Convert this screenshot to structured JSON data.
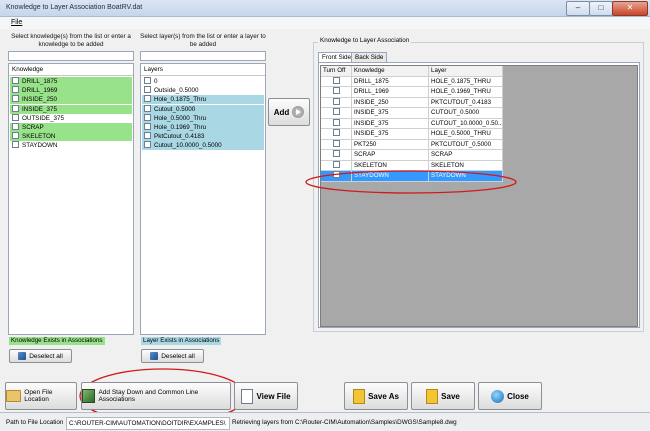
{
  "window": {
    "title": "Knowledge to Layer Association BoatRV.dat"
  },
  "menu": {
    "file": "File"
  },
  "knowledge_panel": {
    "instruction": "Select knowledge(s) from the list or enter a knowledge to be added",
    "search_value": "",
    "header": "Knowledge",
    "items": [
      {
        "label": "DRILL_1875",
        "exists": true
      },
      {
        "label": "DRILL_1969",
        "exists": true
      },
      {
        "label": "INSIDE_250",
        "exists": true
      },
      {
        "label": "INSIDE_375",
        "exists": true
      },
      {
        "label": "OUTSIDE_375",
        "exists": false
      },
      {
        "label": "SCRAP",
        "exists": true
      },
      {
        "label": "SKELETON",
        "exists": true
      },
      {
        "label": "STAYDOWN",
        "exists": false
      }
    ],
    "legend": "Knowledge Exists in Associations",
    "deselect_label": "Deselect all",
    "highlight_color": "#98e28a"
  },
  "layer_panel": {
    "instruction": "Select layer(s) from the list or enter a layer to be added",
    "search_value": "",
    "header": "Layers",
    "items": [
      {
        "label": "0",
        "exists": false
      },
      {
        "label": "Outside_0.5000",
        "exists": false
      },
      {
        "label": "Hole_0.1875_Thru",
        "exists": true
      },
      {
        "label": "Cutout_0.5000",
        "exists": true
      },
      {
        "label": "Hole_0.5000_Thru",
        "exists": true
      },
      {
        "label": "Hole_0.1969_Thru",
        "exists": true
      },
      {
        "label": "PktCutout_0.4183",
        "exists": true
      },
      {
        "label": "Cutout_10.0000_0.5000",
        "exists": true
      }
    ],
    "legend": "Layer Exists in Associations",
    "deselect_label": "Deselect all",
    "highlight_color": "#a9d8e4"
  },
  "add_button": {
    "label": "Add"
  },
  "association": {
    "group_label": "Knowledge to Layer Association",
    "tabs": [
      {
        "label": "Front Side",
        "active": true
      },
      {
        "label": "Back Side",
        "active": false
      }
    ],
    "columns": [
      "Turn Off",
      "Knowledge",
      "Layer"
    ],
    "rows": [
      {
        "knowledge": "DRILL_1875",
        "layer": "HOLE_0.1875_THRU",
        "selected": false
      },
      {
        "knowledge": "DRILL_1969",
        "layer": "HOLE_0.1969_THRU",
        "selected": false
      },
      {
        "knowledge": "INSIDE_250",
        "layer": "PKTCUTOUT_0.4183",
        "selected": false
      },
      {
        "knowledge": "INSIDE_375",
        "layer": "CUTOUT_0.5000",
        "selected": false
      },
      {
        "knowledge": "INSIDE_375",
        "layer": "CUTOUT_10.0000_0.50...",
        "selected": false
      },
      {
        "knowledge": "INSIDE_375",
        "layer": "HOLE_0.5000_THRU",
        "selected": false
      },
      {
        "knowledge": "PKT250",
        "layer": "PKTCUTOUT_0.5000",
        "selected": false
      },
      {
        "knowledge": "SCRAP",
        "layer": "SCRAP",
        "selected": false
      },
      {
        "knowledge": "SKELETON",
        "layer": "SKELETON",
        "selected": false
      },
      {
        "knowledge": "STAYDOWN",
        "layer": "STAYDOWN",
        "selected": true
      }
    ],
    "selected_color": "#3399ff"
  },
  "toolbar": {
    "open_location": "Open File Location",
    "add_staydown": "Add Stay Down and Common Line Associations",
    "view_file": "View File",
    "save_as": "Save As",
    "save": "Save",
    "close": "Close"
  },
  "status": {
    "path_label": "Path to File Location",
    "path_value": "C:\\ROUTER-CIM\\AUTOMATION\\DOITDIR\\EXAMPLES\\",
    "message": "Retrieving layers from C:\\Router-CIM\\Automation\\Samples\\DWGS\\Sample8.dwg"
  },
  "annotation_color": "#d11a1a"
}
